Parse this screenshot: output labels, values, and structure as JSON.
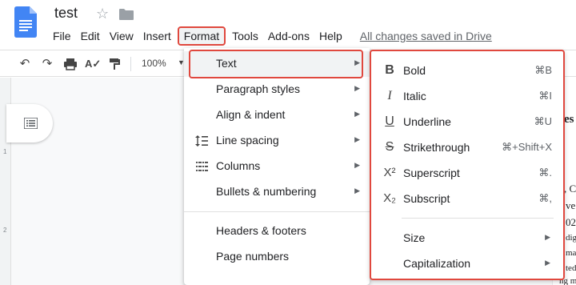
{
  "doc": {
    "title": "test"
  },
  "menubar": {
    "items": [
      "File",
      "Edit",
      "View",
      "Insert",
      "Format",
      "Tools",
      "Add-ons",
      "Help"
    ],
    "saved_status": "All changes saved in Drive"
  },
  "toolbar": {
    "zoom": "100%"
  },
  "ruler": {
    "marks": [
      "1",
      "2"
    ]
  },
  "page_fragments": [
    "es",
    ", C",
    "ve",
    "02",
    "dig",
    "ma",
    "ted",
    "ng maki"
  ],
  "format_menu": {
    "items": [
      {
        "label": "Text",
        "icon": "",
        "has_submenu": true
      },
      {
        "label": "Paragraph styles",
        "icon": "",
        "has_submenu": true
      },
      {
        "label": "Align & indent",
        "icon": "",
        "has_submenu": true
      },
      {
        "label": "Line spacing",
        "icon": "line-spacing-icon",
        "has_submenu": true
      },
      {
        "label": "Columns",
        "icon": "columns-icon",
        "has_submenu": true
      },
      {
        "label": "Bullets & numbering",
        "icon": "",
        "has_submenu": true
      },
      {
        "label": "Headers & footers",
        "icon": "",
        "has_submenu": false
      },
      {
        "label": "Page numbers",
        "icon": "",
        "has_submenu": false
      }
    ]
  },
  "text_submenu": {
    "items": [
      {
        "label": "Bold",
        "shortcut": "⌘B",
        "icon": "bold-icon"
      },
      {
        "label": "Italic",
        "shortcut": "⌘I",
        "icon": "italic-icon"
      },
      {
        "label": "Underline",
        "shortcut": "⌘U",
        "icon": "underline-icon"
      },
      {
        "label": "Strikethrough",
        "shortcut": "⌘+Shift+X",
        "icon": "strikethrough-icon"
      },
      {
        "label": "Superscript",
        "shortcut": "⌘.",
        "icon": "superscript-icon"
      },
      {
        "label": "Subscript",
        "shortcut": "⌘,",
        "icon": "subscript-icon"
      },
      {
        "label": "Size",
        "shortcut": "",
        "icon": ""
      },
      {
        "label": "Capitalization",
        "shortcut": "",
        "icon": ""
      }
    ]
  },
  "colors": {
    "highlight_border": "#e0483e",
    "docs_blue": "#4285f4",
    "link_gray": "#5f6368"
  }
}
